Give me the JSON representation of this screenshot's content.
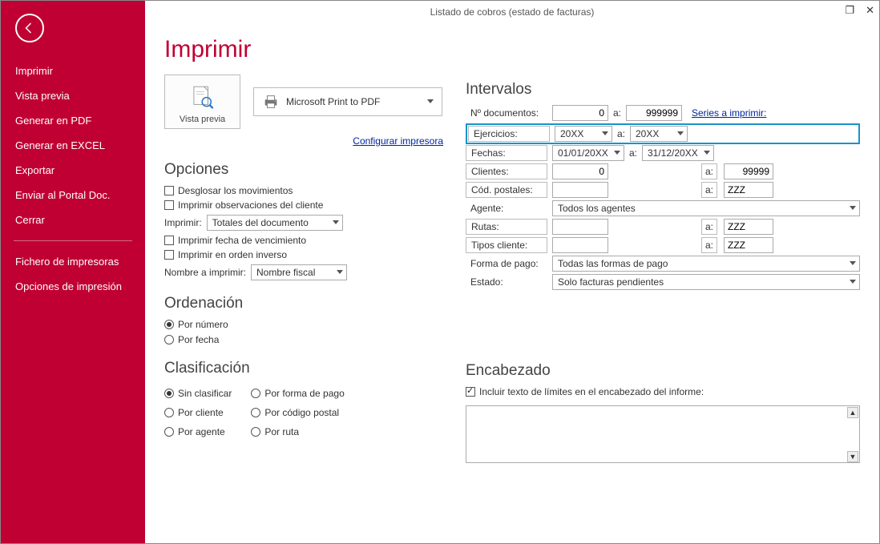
{
  "window": {
    "title": "Listado de cobros (estado de facturas)"
  },
  "sidebar": {
    "items": [
      "Imprimir",
      "Vista previa",
      "Generar en PDF",
      "Generar en EXCEL",
      "Exportar",
      "Enviar al Portal Doc.",
      "Cerrar"
    ],
    "items2": [
      "Fichero de impresoras",
      "Opciones de impresión"
    ]
  },
  "page": {
    "heading": "Imprimir"
  },
  "preview": {
    "label": "Vista previa"
  },
  "printer": {
    "name": "Microsoft Print to PDF",
    "config": "Configurar impresora"
  },
  "opciones": {
    "title": "Opciones",
    "chk_desglosar": "Desglosar los movimientos",
    "chk_obs": "Imprimir observaciones del cliente",
    "imprimir_lbl": "Imprimir:",
    "imprimir_val": "Totales del documento",
    "chk_venc": "Imprimir fecha de vencimiento",
    "chk_inv": "Imprimir en orden inverso",
    "nombre_lbl": "Nombre a imprimir:",
    "nombre_val": "Nombre fiscal"
  },
  "orden": {
    "title": "Ordenación",
    "r1": "Por número",
    "r2": "Por fecha"
  },
  "clasif": {
    "title": "Clasificación",
    "r1": "Sin clasificar",
    "r2": "Por forma de pago",
    "r3": "Por cliente",
    "r4": "Por código postal",
    "r5": "Por agente",
    "r6": "Por ruta"
  },
  "intervalos": {
    "title": "Intervalos",
    "docs_lbl": "Nº documentos:",
    "docs_from": "0",
    "docs_to": "999999",
    "series": "Series a imprimir:",
    "ejer_lbl": "Ejercicios:",
    "ejer_from": "20XX",
    "ejer_to": "20XX",
    "fechas_lbl": "Fechas:",
    "fechas_from": "01/01/20XX",
    "fechas_to": "31/12/20XX",
    "clientes_lbl": "Clientes:",
    "clientes_from": "0",
    "clientes_to": "99999",
    "cp_lbl": "Cód. postales:",
    "cp_from": "",
    "cp_to": "ZZZ",
    "agente_lbl": "Agente:",
    "agente_val": "Todos los agentes",
    "rutas_lbl": "Rutas:",
    "rutas_from": "",
    "rutas_to": "ZZZ",
    "tipos_lbl": "Tipos cliente:",
    "tipos_from": "",
    "tipos_to": "ZZZ",
    "fp_lbl": "Forma de pago:",
    "fp_val": "Todas las formas de pago",
    "estado_lbl": "Estado:",
    "estado_val": "Solo facturas pendientes",
    "a": "a:"
  },
  "encab": {
    "title": "Encabezado",
    "chk": "Incluir texto de límites en el encabezado del informe:",
    "text": ""
  }
}
